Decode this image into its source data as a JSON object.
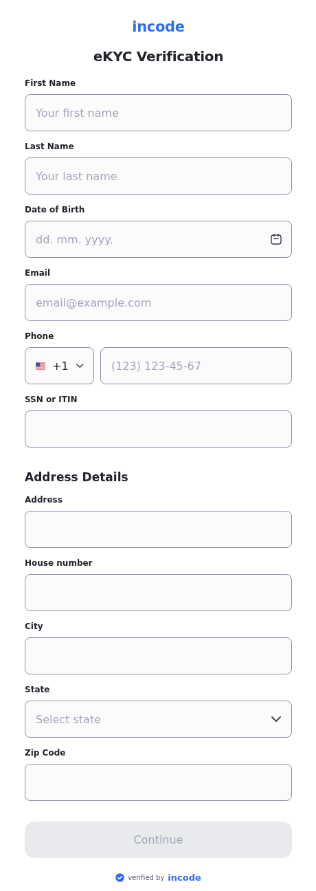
{
  "logo": "incode",
  "title": "eKYC Verification",
  "personal_fields": [
    {
      "kind": "text",
      "label": "First Name",
      "placeholder": "Your first name"
    },
    {
      "kind": "text",
      "label": "Last Name",
      "placeholder": "Your last name"
    },
    {
      "kind": "date",
      "label": "Date of Birth",
      "placeholder": "dd. mm. yyyy."
    },
    {
      "kind": "text",
      "label": "Email",
      "placeholder": "email@example.com"
    },
    {
      "kind": "phone",
      "label": "Phone",
      "country_code": "+1",
      "placeholder": "(123) 123-45-67"
    },
    {
      "kind": "text",
      "label": "SSN or ITIN"
    }
  ],
  "address_section": {
    "heading": "Address Details",
    "fields": [
      {
        "kind": "text",
        "label": "Address"
      },
      {
        "kind": "text",
        "label": "House number"
      },
      {
        "kind": "text",
        "label": "City"
      },
      {
        "kind": "select",
        "label": "State",
        "placeholder": "Select state"
      },
      {
        "kind": "text",
        "label": "Zip Code"
      }
    ]
  },
  "continue_button": {
    "label": "Continue",
    "disabled": true
  },
  "footer": {
    "text": "verified by",
    "brand": "incode"
  }
}
